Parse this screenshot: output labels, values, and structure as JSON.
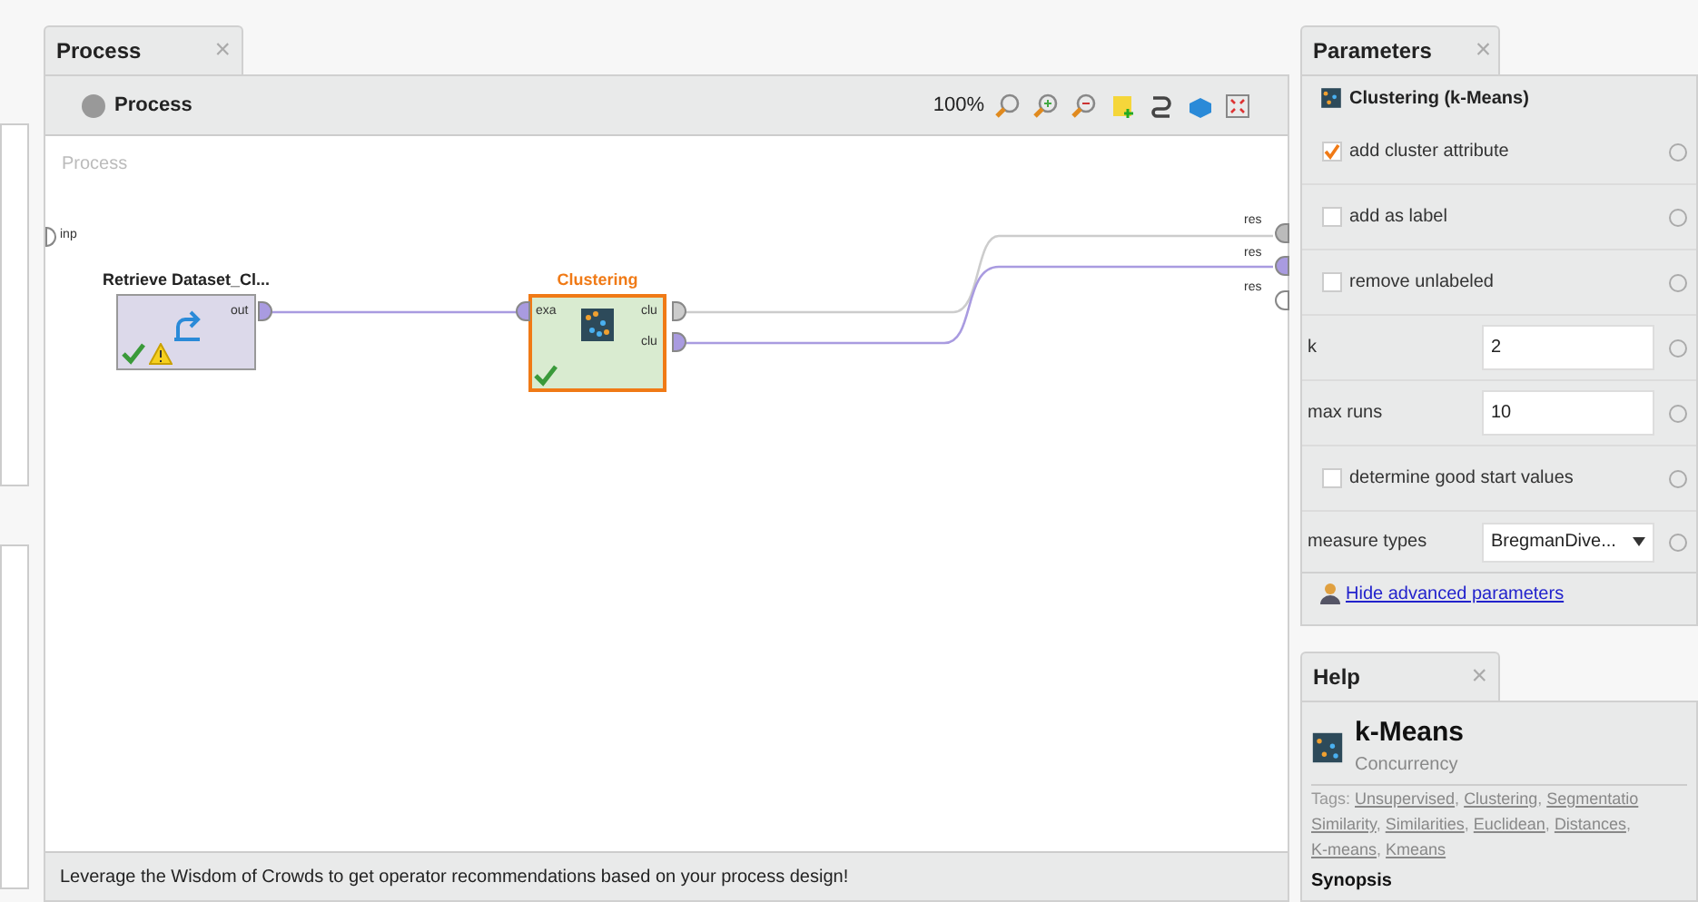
{
  "process_tab": {
    "label": "Process",
    "close": "×",
    "selected": true
  },
  "breadcrumb": "Process",
  "toolbar": {
    "zoom": "100%"
  },
  "canvas": {
    "title": "Process",
    "input_port": "inp",
    "result_ports": [
      "res",
      "res",
      "res"
    ]
  },
  "operators": [
    {
      "kind": "retrieve",
      "title": "Retrieve Dataset_Cl...",
      "selected": false,
      "ports_out": [
        "out"
      ],
      "warning": true
    },
    {
      "kind": "clustering",
      "title": "Clustering",
      "selected": true,
      "ports_in": [
        "exa"
      ],
      "ports_out": [
        "clu",
        "clu"
      ],
      "warning": false
    }
  ],
  "recommendation": "Leverage the Wisdom of Crowds to get operator recommendations based on your process design!",
  "parameters_tab": {
    "label": "Parameters",
    "close": "×",
    "selected": true
  },
  "operator_name": "Clustering (k-Means)",
  "parameters": [
    {
      "kind": "checkbox",
      "label": "add cluster attribute",
      "checked": true
    },
    {
      "kind": "checkbox",
      "label": "add as label",
      "checked": false
    },
    {
      "kind": "checkbox",
      "label": "remove unlabeled",
      "checked": false
    },
    {
      "kind": "number",
      "label": "k",
      "value": "2"
    },
    {
      "kind": "number",
      "label": "max runs",
      "value": "10"
    },
    {
      "kind": "checkbox",
      "label": "determine good start values",
      "checked": false
    },
    {
      "kind": "dropdown",
      "label": "measure types",
      "value": "BregmanDive..."
    }
  ],
  "advanced_link": "Hide advanced parameters",
  "help_tab": {
    "label": "Help",
    "close": "×",
    "selected": true
  },
  "help": {
    "title": "k-Means",
    "subtitle": "Concurrency",
    "tags_label": "Tags:",
    "tags": [
      {
        "label": "Unsupervised",
        "separator": ","
      },
      {
        "label": "Clustering",
        "separator": ","
      },
      {
        "label": "Segmentatio"
      },
      {
        "label": "Similarity",
        "separator": ","
      },
      {
        "label": "Similarities",
        "separator": ","
      },
      {
        "label": "Euclidean",
        "separator": ","
      },
      {
        "label": "Distances",
        "separator": ","
      },
      {
        "label": "K-means",
        "separator": ","
      },
      {
        "label": "Kmeans"
      }
    ],
    "section": "Synopsis"
  }
}
